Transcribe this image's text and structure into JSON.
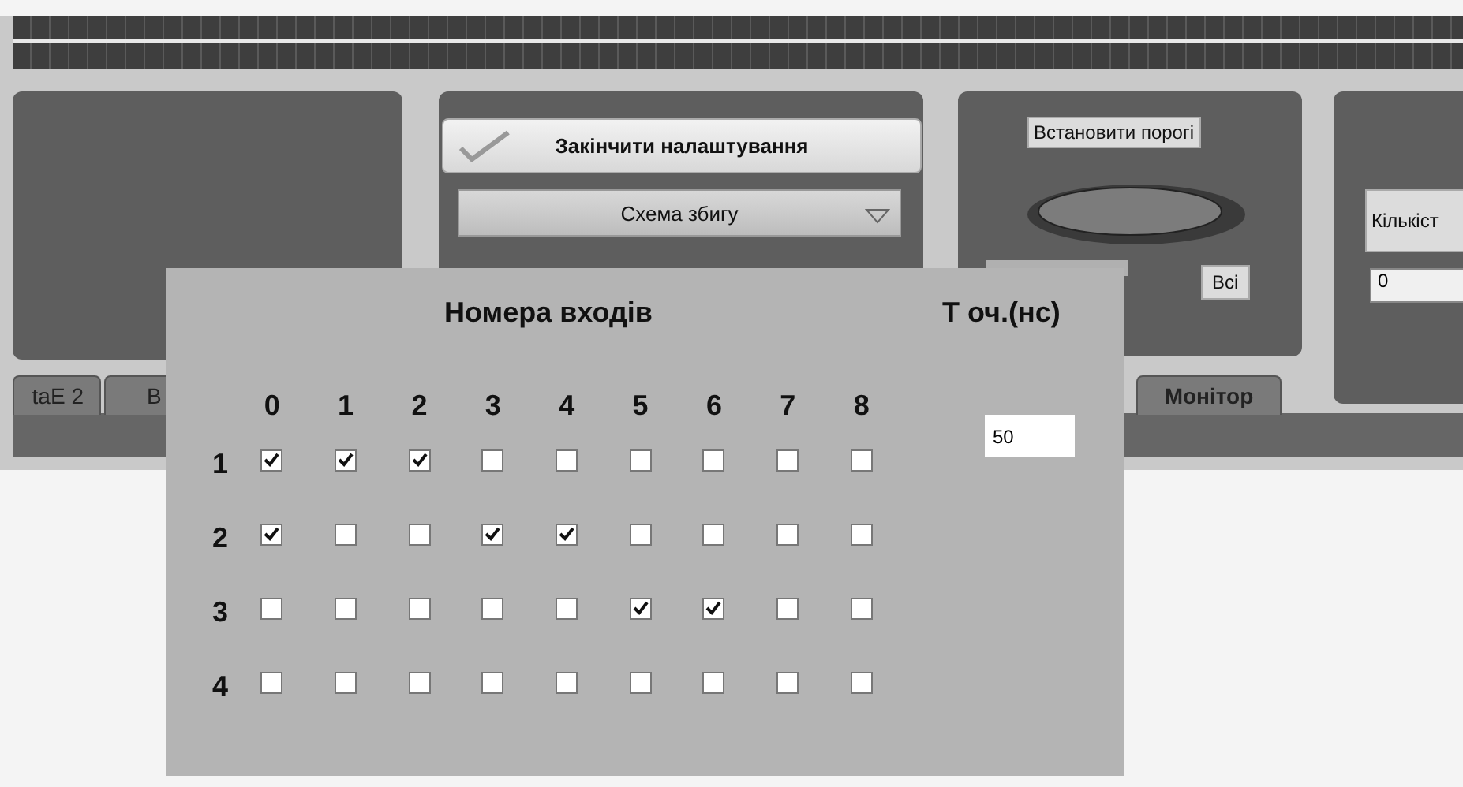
{
  "front_panel": {
    "finish_button": {
      "label": "Закінчити налаштування"
    },
    "mode_dropdown": {
      "value": "Схема збигу"
    },
    "threshold_label": "Встановити порогі",
    "all_label": "Всі",
    "count_label": "Кількіст",
    "count_field": {
      "value": "0"
    },
    "tabs": [
      {
        "label": "taE 2"
      },
      {
        "label": "В"
      },
      {
        "label": "Монітор"
      }
    ]
  },
  "inputs_popup": {
    "title": "Номера входів",
    "columns": [
      "0",
      "1",
      "2",
      "3",
      "4",
      "5",
      "6",
      "7",
      "8"
    ],
    "rows": [
      {
        "label": "1",
        "checks": [
          true,
          true,
          true,
          false,
          false,
          false,
          false,
          false,
          false
        ]
      },
      {
        "label": "2",
        "checks": [
          true,
          false,
          false,
          true,
          true,
          false,
          false,
          false,
          false
        ]
      },
      {
        "label": "3",
        "checks": [
          false,
          false,
          false,
          false,
          false,
          true,
          true,
          false,
          false
        ]
      },
      {
        "label": "4",
        "checks": [
          false,
          false,
          false,
          false,
          false,
          false,
          false,
          false,
          false
        ]
      }
    ],
    "time_label": "Т оч.(нс)",
    "time_field": {
      "value": "50"
    }
  }
}
